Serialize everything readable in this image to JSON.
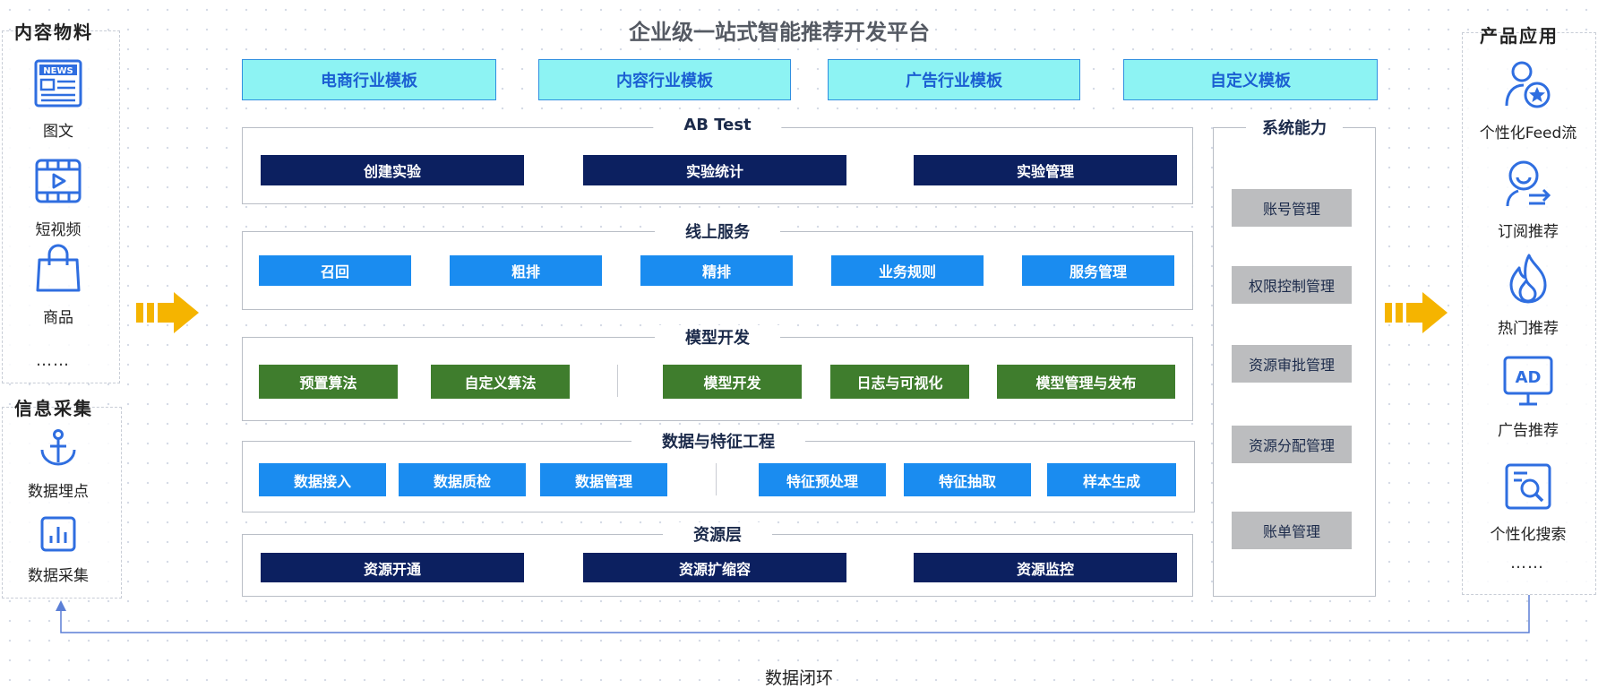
{
  "title": "企业级一站式智能推荐开发平台",
  "left_content": {
    "title": "内容物料",
    "items": [
      {
        "label": "图文",
        "icon": "news-icon"
      },
      {
        "label": "短视频",
        "icon": "video-icon"
      },
      {
        "label": "商品",
        "icon": "shopping-bag-icon"
      }
    ],
    "more": "……"
  },
  "left_collect": {
    "title": "信息采集",
    "items": [
      {
        "label": "数据埋点",
        "icon": "anchor-icon"
      },
      {
        "label": "数据采集",
        "icon": "bar-chart-icon"
      }
    ]
  },
  "templates": [
    "电商行业模板",
    "内容行业模板",
    "广告行业模板",
    "自定义模板"
  ],
  "ab_test": {
    "title": "AB Test",
    "items": [
      "创建实验",
      "实验统计",
      "实验管理"
    ]
  },
  "online_service": {
    "title": "线上服务",
    "items": [
      "召回",
      "粗排",
      "精排",
      "业务规则",
      "服务管理"
    ]
  },
  "model_dev": {
    "title": "模型开发",
    "items": [
      "预置算法",
      "自定义算法",
      "模型开发",
      "日志与可视化",
      "模型管理与发布"
    ]
  },
  "data_feature": {
    "title": "数据与特征工程",
    "items": [
      "数据接入",
      "数据质检",
      "数据管理",
      "特征预处理",
      "特征抽取",
      "样本生成"
    ]
  },
  "resource": {
    "title": "资源层",
    "items": [
      "资源开通",
      "资源扩缩容",
      "资源监控"
    ]
  },
  "system": {
    "title": "系统能力",
    "items": [
      "账号管理",
      "权限控制管理",
      "资源审批管理",
      "资源分配管理",
      "账单管理"
    ]
  },
  "right_apps": {
    "title": "产品应用",
    "items": [
      {
        "label": "个性化Feed流",
        "icon": "user-star-icon"
      },
      {
        "label": "订阅推荐",
        "icon": "user-subscribe-icon"
      },
      {
        "label": "热门推荐",
        "icon": "flame-icon"
      },
      {
        "label": "广告推荐",
        "icon": "ad-icon"
      },
      {
        "label": "个性化搜索",
        "icon": "search-doc-icon"
      }
    ],
    "more": "……"
  },
  "loop_label": "数据闭环",
  "colors": {
    "navy": "#0c2060",
    "blue": "#1a8cf0",
    "green": "#3f7d2d",
    "gray": "#bcbdbf",
    "cyan": "#8df3f3",
    "arrow": "#f5b400",
    "icon": "#2f6ee0"
  }
}
